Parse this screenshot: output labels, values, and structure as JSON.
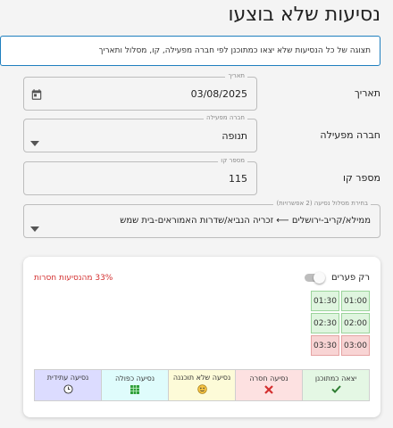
{
  "page": {
    "title": "נסיעות שלא בוצעו",
    "info": "תצוגה של כל הנסיעות שלא יצאו כמתוכנן לפי חברה מפעילה, קו, מסלול ותאריך"
  },
  "form": {
    "date": {
      "label": "תאריך",
      "legend": "תאריך",
      "value": "03/08/2025"
    },
    "operator": {
      "label": "חברה מפעילה",
      "legend": "חברה מפעילה",
      "value": "תנופה"
    },
    "line": {
      "label": "מספר קו",
      "legend": "מספר קו",
      "value": "115"
    },
    "route": {
      "legend": "בחירת מסלול נסיעה (2 אפשרויות)",
      "value": "ממילא/קריב-ירושלים ⟵ זכריה הנביא/שדרות האמוראים-בית שמש"
    }
  },
  "card": {
    "missed_text": "33% מהנסיעות חסרות",
    "toggle_label": "רק פערים",
    "times": [
      {
        "time": "01:00",
        "status": "ok"
      },
      {
        "time": "01:30",
        "status": "ok"
      },
      {
        "time": "02:00",
        "status": "ok"
      },
      {
        "time": "02:30",
        "status": "ok"
      },
      {
        "time": "03:00",
        "status": "missed"
      },
      {
        "time": "03:30",
        "status": "missed"
      }
    ],
    "legend": [
      {
        "label": "יצאה כמתוכנן",
        "icon": "check-icon",
        "color": "#e4f7e4"
      },
      {
        "label": "נסיעה חסרה",
        "icon": "x-icon",
        "color": "#fde1e1"
      },
      {
        "label": "נסיעה שלא תוכננה",
        "icon": "smiley-icon",
        "color": "#fdfbd8"
      },
      {
        "label": "נסיעה כפולה",
        "icon": "grid-icon",
        "color": "#dffcfc"
      },
      {
        "label": "נסיעה עתידית",
        "icon": "clock-icon",
        "color": "#dcdcff"
      }
    ]
  },
  "colors": {
    "accent": "#1f7fbf",
    "missed_text": "#d32f2f"
  }
}
